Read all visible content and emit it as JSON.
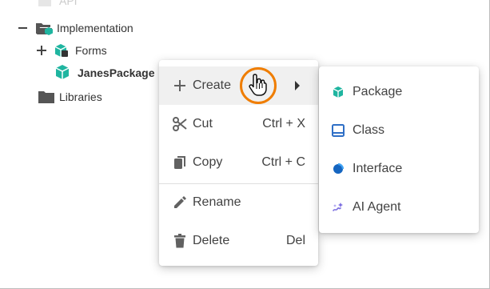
{
  "tree": {
    "api_label": "API",
    "implementation_label": "Implementation",
    "forms_label": "Forms",
    "janes_package_label": "JanesPackage",
    "libraries_label": "Libraries"
  },
  "context_menu": {
    "create": "Create",
    "cut": "Cut",
    "cut_shortcut": "Ctrl + X",
    "copy": "Copy",
    "copy_shortcut": "Ctrl + C",
    "rename": "Rename",
    "delete": "Delete",
    "delete_shortcut": "Del"
  },
  "submenu": {
    "package": "Package",
    "class": "Class",
    "interface": "Interface",
    "ai_agent": "AI Agent"
  },
  "colors": {
    "package_teal": "#1fb5a0",
    "class_blue": "#2f6fc6",
    "interface_blue": "#1565c0",
    "ai_agent_purple": "#7b6ee0",
    "cursor_highlight": "#ef7d00"
  }
}
